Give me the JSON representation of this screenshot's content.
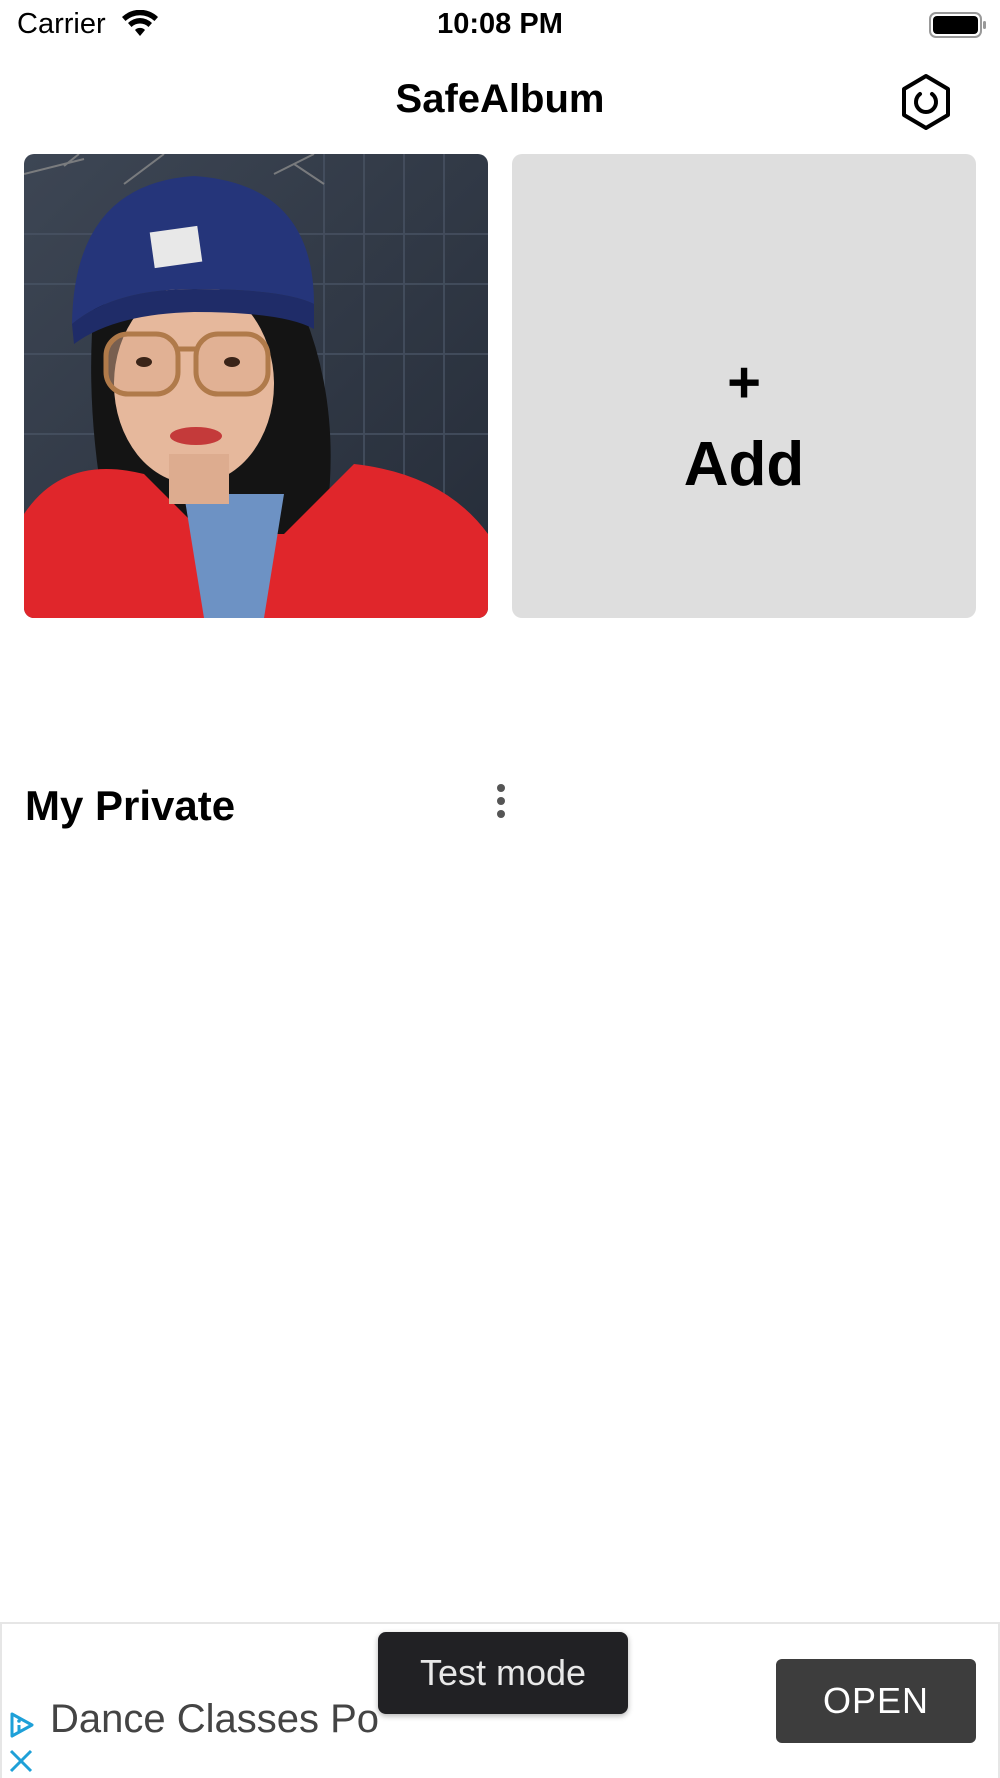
{
  "status_bar": {
    "carrier": "Carrier",
    "time": "10:08 PM",
    "wifi_icon": "wifi-icon",
    "battery_icon": "battery-full-icon"
  },
  "nav": {
    "title": "SafeAlbum",
    "settings_icon": "settings-hexagon-icon"
  },
  "albums": [
    {
      "name": "My Private",
      "cover": "photo-woman-blue-beanie-red-jacket",
      "menu_icon": "more-vertical-icon"
    }
  ],
  "add_card": {
    "plus": "+",
    "label": "Add"
  },
  "ad": {
    "title": "Dance Classes Po",
    "button": "OPEN",
    "badge": "Test mode",
    "choices_icon": "ad-choices-icon",
    "close_icon": "close-icon"
  },
  "colors": {
    "add_card_bg": "#dedede",
    "ad_button_bg": "#3d3d3d",
    "test_mode_bg": "#212124"
  }
}
